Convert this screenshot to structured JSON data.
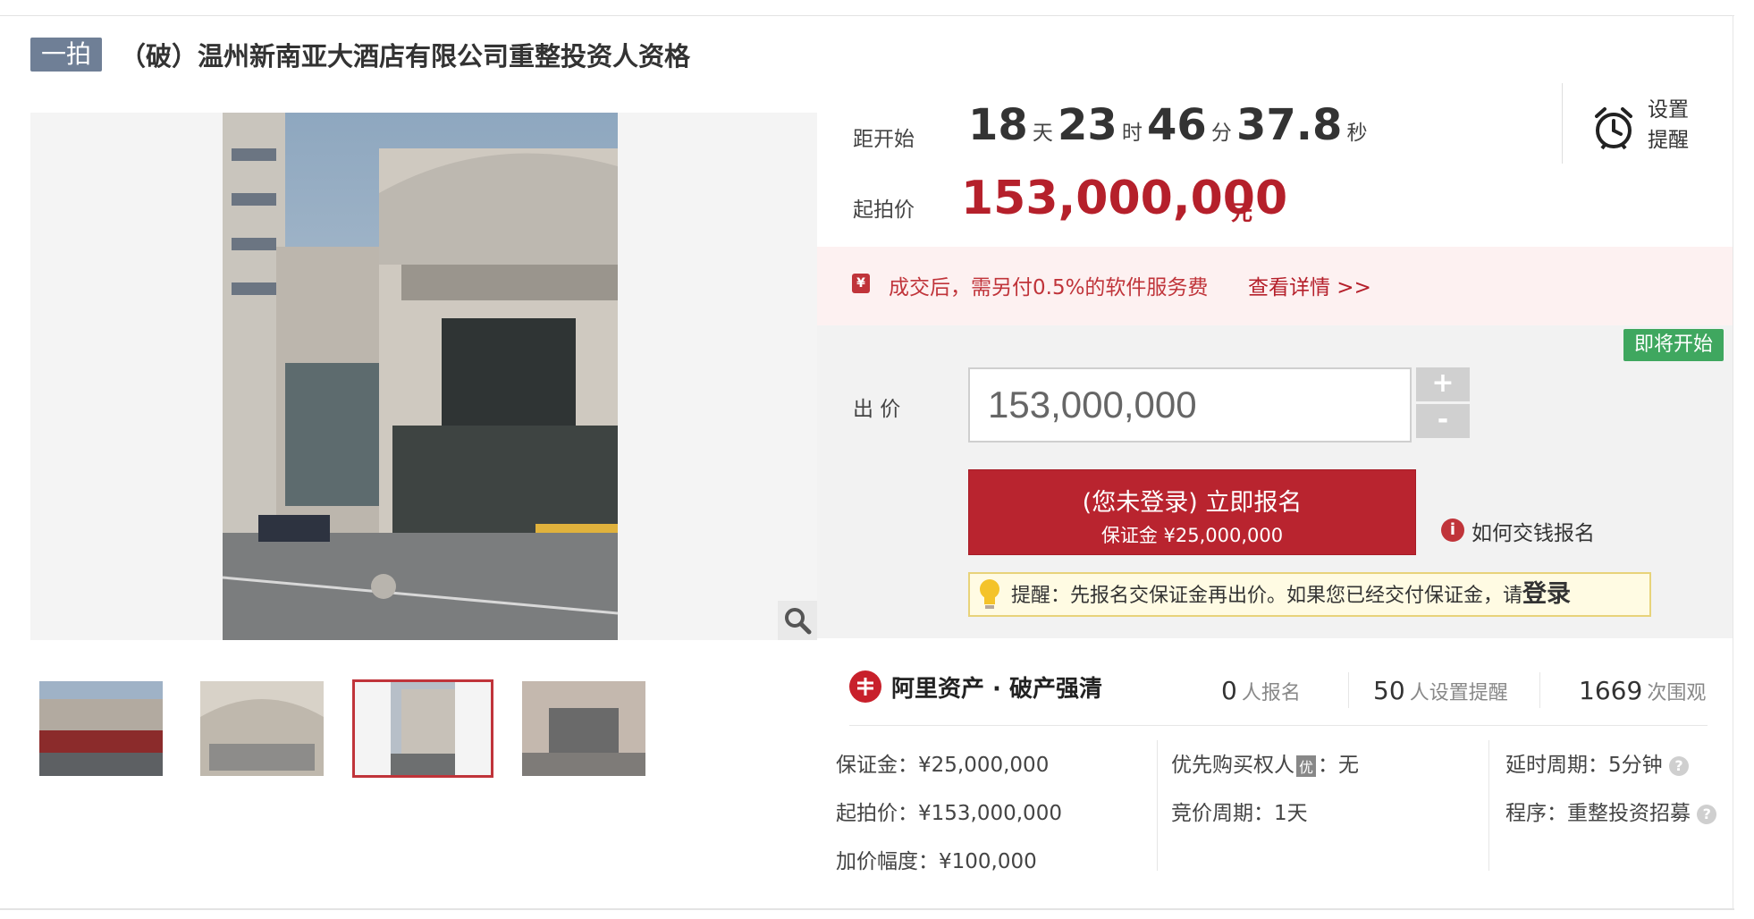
{
  "header": {
    "tag": "一拍",
    "title": "（破）温州新南亚大酒店有限公司重整投资人资格"
  },
  "countdown": {
    "label": "距开始",
    "days": "18",
    "days_unit": "天",
    "hours": "23",
    "hours_unit": "时",
    "minutes": "46",
    "minutes_unit": "分",
    "seconds": "37.8",
    "seconds_unit": "秒"
  },
  "reminder": {
    "line1": "设置",
    "line2": "提醒",
    "icon": "alarm-clock-icon"
  },
  "start_price": {
    "label": "起拍价",
    "value": "153,000,000",
    "unit": "元"
  },
  "notice": {
    "text": "成交后，需另付0.5%的软件服务费",
    "link": "查看详情 >>"
  },
  "status_badge": "即将开始",
  "bid": {
    "label": "出 价",
    "value": "153,000,000",
    "plus": "+",
    "minus": "-"
  },
  "signup": {
    "main": "(您未登录) 立即报名",
    "sub": "保证金 ¥25,000,000",
    "help": "如何交钱报名"
  },
  "tip": {
    "text": "提醒：先报名交保证金再出价。如果您已经交付保证金，请",
    "link": "登录"
  },
  "seller": {
    "name": "阿里资产 · 破产强清"
  },
  "stats": {
    "signups": "0",
    "signups_label": "人报名",
    "reminders": "50",
    "reminders_label": "人设置提醒",
    "views": "1669",
    "views_label": "次围观"
  },
  "details": {
    "deposit": "保证金：¥25,000,000",
    "start_price": "起拍价：¥153,000,000",
    "increment": "加价幅度：¥100,000",
    "priority_label": "优先购买权人",
    "priority_badge": "优",
    "priority_value": "：无",
    "cycle": "竞价周期：1天",
    "delay": "延时周期：5分钟",
    "procedure": "程序：重整投资招募"
  },
  "colors": {
    "accent": "#b9242f",
    "price": "#b5202b",
    "badge": "#3fa75f",
    "tag": "#6f7f96"
  }
}
